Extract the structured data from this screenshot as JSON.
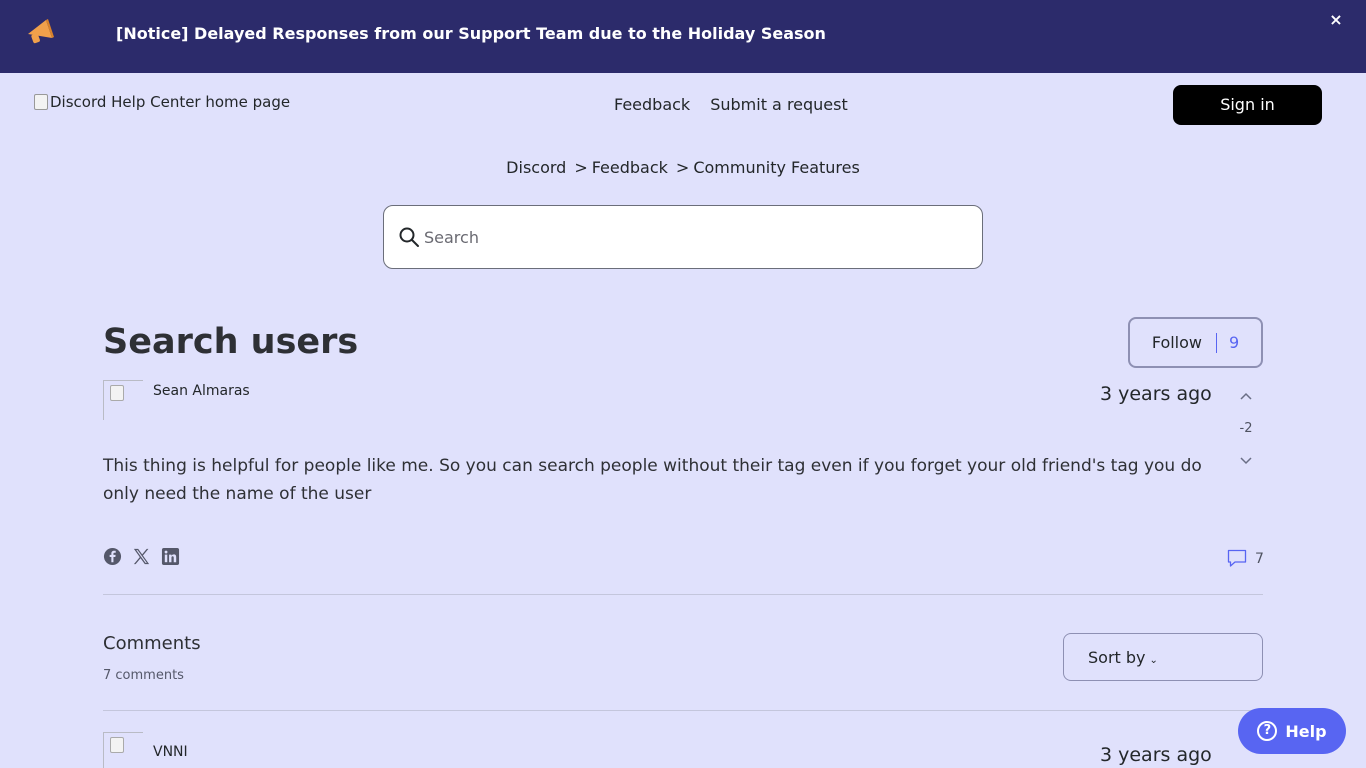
{
  "notice": {
    "text": "[Notice] Delayed Responses from our Support Team due to the Holiday Season",
    "close_label": "×",
    "icon": "megaphone-icon"
  },
  "header": {
    "logo_alt": "Discord Help Center home page",
    "nav": [
      "Feedback",
      "Submit a request"
    ],
    "signin_label": "Sign in"
  },
  "breadcrumb": [
    "Discord",
    "Feedback",
    "Community Features"
  ],
  "search": {
    "placeholder": "Search"
  },
  "post": {
    "title": "Search users",
    "follow_label": "Follow",
    "follow_count": "9",
    "author": "Sean Almaras",
    "time": "3 years ago",
    "vote_count": "-2",
    "body": "This thing is helpful for people like me. So you can search people without their tag even if you forget your old friend's tag you do only need the name of the user",
    "comment_count": "7"
  },
  "comments": {
    "title": "Comments",
    "subtitle": "7 comments",
    "sort_label": "Sort by",
    "first": {
      "author": "VNNI",
      "time": "3 years ago"
    }
  },
  "help": {
    "label": "Help"
  },
  "colors": {
    "notice_bg": "#2c2b6b",
    "page_bg": "#e0e1fc",
    "accent": "#5865f2"
  }
}
